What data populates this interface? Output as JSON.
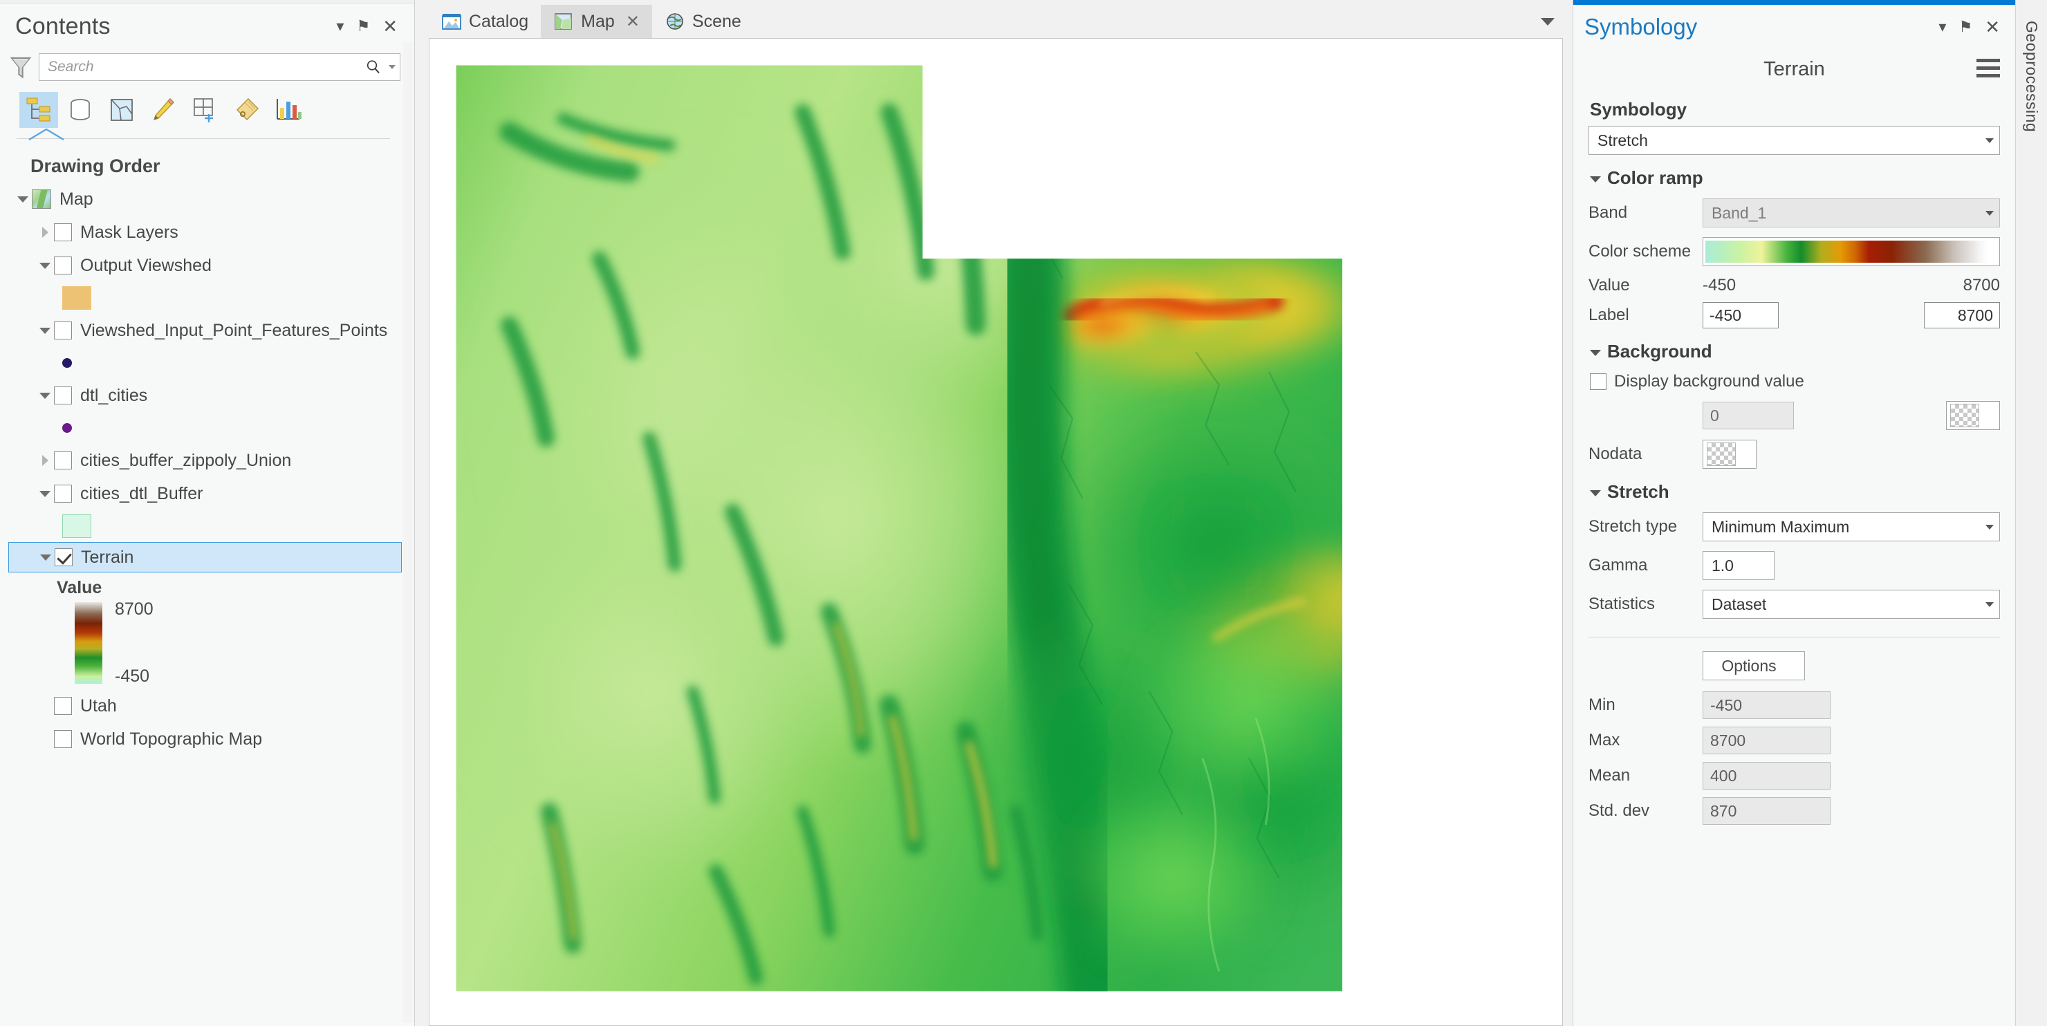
{
  "contents": {
    "title": "Contents",
    "header_buttons": [
      {
        "name": "menu-caret",
        "label": "▾"
      },
      {
        "name": "pin",
        "label": "⚑"
      },
      {
        "name": "close",
        "label": "✕"
      }
    ],
    "search": {
      "placeholder": "Search",
      "value": ""
    },
    "toolbar": [
      {
        "name": "list-by-drawing-order",
        "active": true
      },
      {
        "name": "list-by-data-source",
        "active": false
      },
      {
        "name": "list-by-selection",
        "active": false
      },
      {
        "name": "list-by-editing",
        "active": false
      },
      {
        "name": "list-by-snapping",
        "active": false
      },
      {
        "name": "list-by-labeling",
        "active": false
      },
      {
        "name": "list-by-charts",
        "active": false
      }
    ],
    "section_title": "Drawing Order",
    "tree": [
      {
        "label": "Map",
        "checked": null,
        "expanded": true,
        "kind": "map"
      },
      {
        "label": "Mask Layers",
        "checked": false,
        "expanded": false,
        "kind": "group"
      },
      {
        "label": "Output Viewshed",
        "checked": false,
        "expanded": true,
        "kind": "raster"
      },
      {
        "label": "Viewshed_Input_Point_Features_Points",
        "checked": false,
        "expanded": true,
        "kind": "point"
      },
      {
        "label": "dtl_cities",
        "checked": false,
        "expanded": true,
        "kind": "point"
      },
      {
        "label": "cities_buffer_zippoly_Union",
        "checked": false,
        "expanded": false,
        "kind": "poly"
      },
      {
        "label": "cities_dtl_Buffer",
        "checked": false,
        "expanded": true,
        "kind": "poly"
      },
      {
        "label": "Terrain",
        "checked": true,
        "expanded": true,
        "kind": "raster",
        "selected": true
      },
      {
        "label": "Utah",
        "checked": false,
        "expanded": false,
        "kind": "poly"
      },
      {
        "label": "World Topographic Map",
        "checked": false,
        "expanded": false,
        "kind": "basemap"
      }
    ],
    "swatches": {
      "output_viewshed": "#eec275",
      "viewshed_points": "#241a68",
      "dtl_cities_point": "#6a1a8c",
      "cities_dtl_buffer": "#d9f7e5"
    },
    "terrain_legend": {
      "value_label": "Value",
      "max": "8700",
      "min": "-450"
    }
  },
  "tabs": [
    {
      "label": "Catalog",
      "icon": "catalog-icon",
      "active": false,
      "closable": false
    },
    {
      "label": "Map",
      "icon": "map-icon",
      "active": true,
      "closable": true
    },
    {
      "label": "Scene",
      "icon": "globe-icon",
      "active": false,
      "closable": false
    }
  ],
  "symbology": {
    "title": "Symbology",
    "header_buttons": [
      {
        "name": "menu-caret",
        "label": "▾"
      },
      {
        "name": "pin",
        "label": "⚑"
      },
      {
        "name": "close",
        "label": "✕"
      }
    ],
    "layer_name": "Terrain",
    "symbology_label": "Symbology",
    "symbology_value": "Stretch",
    "color_ramp": {
      "heading": "Color ramp",
      "band_label": "Band",
      "band_value": "Band_1",
      "color_scheme_label": "Color scheme",
      "value_label": "Value",
      "value_min": "-450",
      "value_max": "8700",
      "label_label": "Label",
      "label_min": "-450",
      "label_max": "8700"
    },
    "background": {
      "heading": "Background",
      "display_bg_label": "Display background value",
      "display_bg_checked": false,
      "bg_value": "0",
      "nodata_label": "Nodata"
    },
    "stretch": {
      "heading": "Stretch",
      "stretch_type_label": "Stretch type",
      "stretch_type_value": "Minimum Maximum",
      "gamma_label": "Gamma",
      "gamma_value": "1.0",
      "statistics_label": "Statistics",
      "statistics_value": "Dataset",
      "options_label": "Options",
      "stats": [
        {
          "label": "Min",
          "value": "-450"
        },
        {
          "label": "Max",
          "value": "8700"
        },
        {
          "label": "Mean",
          "value": "400"
        },
        {
          "label": "Std. dev",
          "value": "870"
        }
      ]
    }
  },
  "right_rail": {
    "tab_label": "Geoprocessing"
  },
  "colors": {
    "accent": "#0078d4",
    "panel_bg": "#f7f8f8",
    "app_bg": "#f1f1f1",
    "selection": "#cfe7f8"
  }
}
